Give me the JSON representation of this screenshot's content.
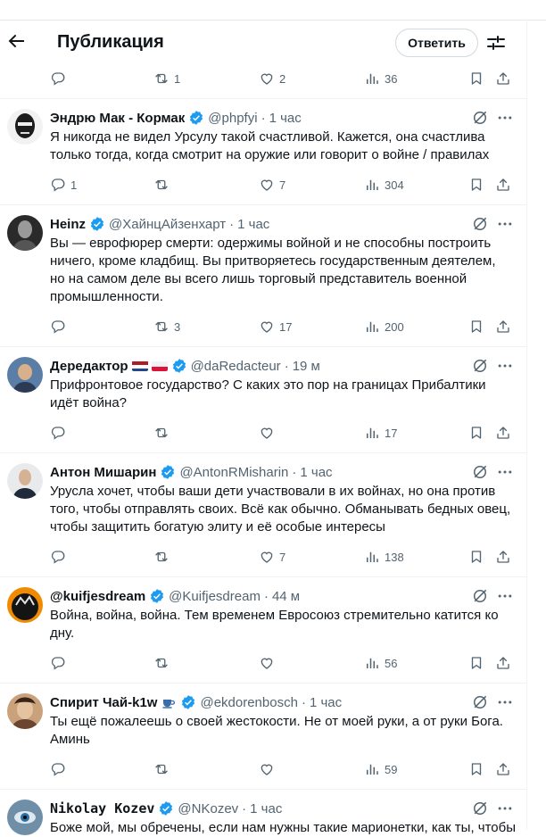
{
  "header": {
    "title": "Публикация",
    "reply_label": "Ответить"
  },
  "top_actions": {
    "replies": "",
    "reposts": "1",
    "likes": "2",
    "views": "36"
  },
  "tweets": [
    {
      "name": "Эндрю Мак - Кормак",
      "handle": "@phpfyi",
      "time": "1 час",
      "text": "Я никогда не видел Урсулу такой счастливой. Кажется, она счастлива только тогда, когда смотрит на оружие или говорит о войне / правилах",
      "replies": "1",
      "reposts": "",
      "likes": "7",
      "views": "304"
    },
    {
      "name": "Heinz",
      "handle": "@ХайнцАйзенхарт",
      "time": "1 час",
      "text": "Вы — еврофюрер смерти: одержимы войной и не способны построить ничего, кроме кладбищ. Вы притворяетесь государственным деятелем, но на самом деле вы всего лишь торговый представитель военной промышленности.",
      "replies": "",
      "reposts": "3",
      "likes": "17",
      "views": "200"
    },
    {
      "name": "Дередактор",
      "handle": "@daRedacteur",
      "time": "19 м",
      "text": "Прифронтовое государство? С каких это пор на границах Прибалтики идёт война?",
      "replies": "",
      "reposts": "",
      "likes": "",
      "views": "17"
    },
    {
      "name": "Антон Мишарин",
      "handle": "@AntonRMisharin",
      "time": "1 час",
      "text": "Урусла хочет, чтобы ваши дети участвовали в их войнах, но она против того, чтобы отправлять своих. Всё как обычно. Обманывать бедных овец, чтобы защитить богатую элиту и её особые интересы",
      "replies": "",
      "reposts": "",
      "likes": "7",
      "views": "138"
    },
    {
      "name": "@kuifjesdream",
      "handle": "@Kuifjesdream",
      "time": "44 м",
      "text": "Война, война, война. Тем временем Евросоюз стремительно катится ко дну.",
      "replies": "",
      "reposts": "",
      "likes": "",
      "views": "56"
    },
    {
      "name": "Спирит Чай-k1w",
      "handle": "@ekdorenbosch",
      "time": "1 час",
      "text": "Ты ещё пожалеешь о своей жестокости. Не от моей руки, а от руки Бога. Аминь",
      "replies": "",
      "reposts": "",
      "likes": "",
      "views": "59"
    },
    {
      "name": "Nikolay Kozev",
      "handle": "@NKozev",
      "time": "1 час",
      "text": "Боже мой, мы обречены, если нам нужны такие марионетки, как ты, чтобы",
      "replies": "",
      "reposts": "",
      "likes": "",
      "views": ""
    }
  ],
  "colors": {
    "verified": "#1d9bf0",
    "muted": "#536471",
    "text": "#0f1419"
  },
  "icons": [
    "back-arrow-icon",
    "filter-icon",
    "reply-icon",
    "repost-icon",
    "like-icon",
    "views-icon",
    "bookmark-icon",
    "share-icon",
    "grok-icon",
    "more-icon",
    "verified-badge-icon",
    "teacup-icon",
    "netherlands-flag-icon",
    "poland-flag-icon"
  ]
}
